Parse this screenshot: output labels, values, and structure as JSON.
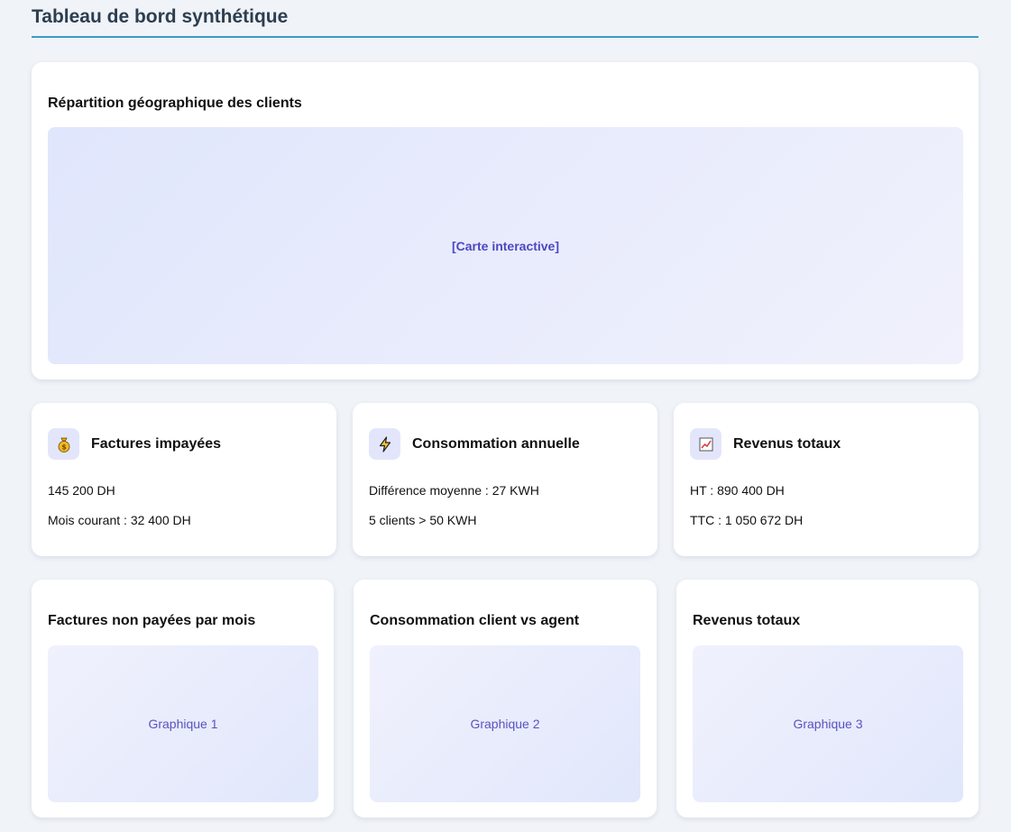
{
  "header": {
    "title": "Tableau de bord synthétique"
  },
  "map": {
    "title": "Répartition géographique des clients",
    "placeholder": "[Carte interactive]"
  },
  "stats": [
    {
      "icon": "money-bag-icon",
      "title": "Factures impayées",
      "line1": "145 200 DH",
      "line2": "Mois courant : 32 400 DH"
    },
    {
      "icon": "lightning-icon",
      "title": "Consommation annuelle",
      "line1": "Différence moyenne : 27 KWH",
      "line2": "5 clients > 50 KWH"
    },
    {
      "icon": "chart-up-icon",
      "title": "Revenus totaux",
      "line1": "HT : 890 400 DH",
      "line2": "TTC : 1 050 672 DH"
    }
  ],
  "charts": [
    {
      "title": "Factures non payées par mois",
      "placeholder": "Graphique 1"
    },
    {
      "title": "Consommation client vs agent",
      "placeholder": "Graphique 2"
    },
    {
      "title": "Revenus totaux",
      "placeholder": "Graphique 3"
    }
  ],
  "colors": {
    "background": "#f0f3f8",
    "accent_rule": "#3a9bc9",
    "title": "#2c3e50",
    "placeholder_text": "#4d47c2",
    "icon_bg": "#e3e6fb"
  }
}
